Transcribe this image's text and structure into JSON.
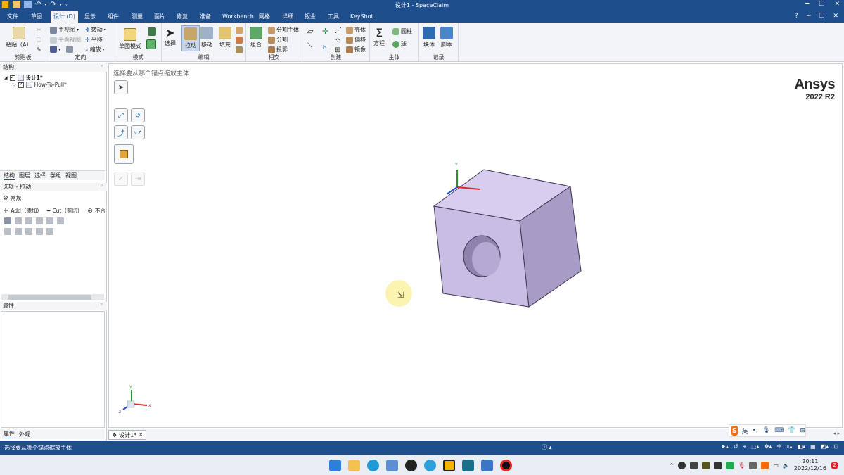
{
  "window": {
    "title": "设计1 - SpaceClaim"
  },
  "menu": {
    "tabs": [
      {
        "label": "文件",
        "active": false
      },
      {
        "label": "草图",
        "active": false
      },
      {
        "label": "设计 (D)",
        "active": true
      },
      {
        "label": "显示",
        "active": false
      },
      {
        "label": "组件",
        "active": false
      },
      {
        "label": "测量",
        "active": false
      },
      {
        "label": "面片",
        "active": false
      },
      {
        "label": "修复",
        "active": false
      },
      {
        "label": "准备",
        "active": false
      },
      {
        "label": "Workbench",
        "active": false
      },
      {
        "label": "网格",
        "active": false
      },
      {
        "label": "详细",
        "active": false
      },
      {
        "label": "钣金",
        "active": false
      },
      {
        "label": "工具",
        "active": false
      },
      {
        "label": "KeyShot",
        "active": false
      }
    ]
  },
  "ribbon": {
    "clipboard": {
      "label": "剪贴板",
      "paste": "粘贴（A）"
    },
    "orient": {
      "label": "定向",
      "home": "主视图",
      "plane": "平面视图",
      "spin": "转动",
      "pan": "平移",
      "zoom": "缩放"
    },
    "mode": {
      "label": "模式",
      "sketch": "草图模式"
    },
    "edit": {
      "label": "编辑",
      "select": "选择",
      "pull": "拉动",
      "move": "移动",
      "fill": "填充"
    },
    "intersect": {
      "label": "相交",
      "combine": "组合",
      "split_body": "分割主体",
      "split": "分割",
      "project": "投影"
    },
    "create": {
      "label": "创建",
      "shell": "壳体",
      "offset": "偏移",
      "mirror": "镜像"
    },
    "body": {
      "label": "主体",
      "equation": "方程",
      "cylinder": "圆柱",
      "sphere": "球"
    },
    "record": {
      "label": "记录",
      "block": "块体",
      "script": "脚本"
    }
  },
  "structure": {
    "header": "结构",
    "root": "设计1*",
    "child": "How-To-Pull*"
  },
  "left_tabs": [
    "结构",
    "图层",
    "选择",
    "群组",
    "视图"
  ],
  "options": {
    "header": "选项 - 拉动",
    "general": "常规",
    "add": "Add（添加）",
    "cut": "Cut（剪切）",
    "no_merge": "不合"
  },
  "properties": {
    "header": "属性"
  },
  "bottom_tabs": [
    "属性",
    "外观"
  ],
  "viewport": {
    "hint": "选择要从哪个锚点缩放主体",
    "brand": "Ansys",
    "version": "2022 R2",
    "axis_x": "x",
    "axis_y": "Y",
    "axis_z": "z"
  },
  "doc_tab": {
    "label": "设计1*"
  },
  "ime": {
    "lang": "英"
  },
  "status": {
    "message": "选择要从哪个锚点缩放主体"
  },
  "taskbar": {
    "time": "20:11",
    "date": "2022/12/16",
    "notif_count": "2"
  },
  "colors": {
    "brand_blue": "#1f4e8c",
    "cube_front": "#c9bde3",
    "cube_side": "#a89cc6",
    "cube_top": "#d8cdef"
  }
}
